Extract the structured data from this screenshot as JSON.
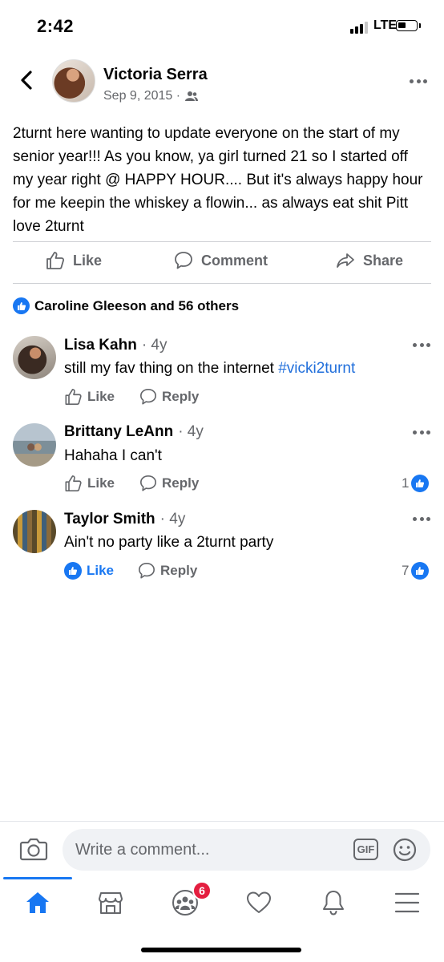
{
  "status_bar": {
    "time": "2:42",
    "network": "LTE"
  },
  "post": {
    "author": "Victoria Serra",
    "date": "Sep 9, 2015 ·",
    "privacy_icon": "friends-icon",
    "text": "2turnt here wanting to update everyone on the start of my senior year!!! As you know, ya girl turned 21 so I started off my year right @ HAPPY HOUR.... But it's always happy hour for me keepin the whiskey a flowin... as always eat shit Pitt love 2turnt"
  },
  "actions": {
    "like": "Like",
    "comment": "Comment",
    "share": "Share"
  },
  "reactions_summary": "Caroline Gleeson and 56 others",
  "comments": [
    {
      "name": "Lisa Kahn",
      "time": "· 4y",
      "text": "still my fav thing on the internet ",
      "hashtag": "#vicki2turnt",
      "like": "Like",
      "reply": "Reply",
      "likes": ""
    },
    {
      "name": "Brittany LeAnn",
      "time": "· 4y",
      "text": "Hahaha I can't",
      "like": "Like",
      "reply": "Reply",
      "likes": "1"
    },
    {
      "name": "Taylor Smith",
      "time": "· 4y",
      "text": "Ain't no party like a 2turnt party",
      "like": "Like",
      "reply": "Reply",
      "likes": "7",
      "liked_by_me": true
    }
  ],
  "composer": {
    "placeholder": "Write a comment...",
    "gif_label": "GIF"
  },
  "tab_bar": {
    "groups_badge": "6"
  },
  "colors": {
    "accent": "#1877f2",
    "secondary_text": "#65676b",
    "badge": "#e41e3f"
  }
}
